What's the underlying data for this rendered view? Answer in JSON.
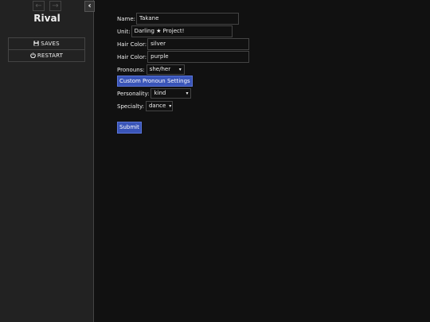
{
  "sidebar": {
    "back_icon": "←",
    "forward_icon": "→",
    "toggle_icon": "‹",
    "title": "Rival",
    "saves_label": "SAVES",
    "restart_label": "RESTART"
  },
  "form": {
    "name_label": "Name:",
    "name_value": "Takane",
    "unit_label": "Unit:",
    "unit_value": "Darling ★ Project!",
    "hair_color_label_1": "Hair Color:",
    "hair_color_value_1": "silver",
    "hair_color_label_2": "Hair Color:",
    "hair_color_value_2": "purple",
    "pronouns_label": "Pronouns:",
    "pronouns_value": "she/her",
    "custom_pronoun_label": "Custom Pronoun Settings",
    "personality_label": "Personality:",
    "personality_value": "kind",
    "specialty_label": "Specialty:",
    "specialty_value": "dance",
    "submit_label": "Submit"
  },
  "colors": {
    "background": "#111111",
    "sidebar": "#222222",
    "accent": "#3a55b8"
  }
}
